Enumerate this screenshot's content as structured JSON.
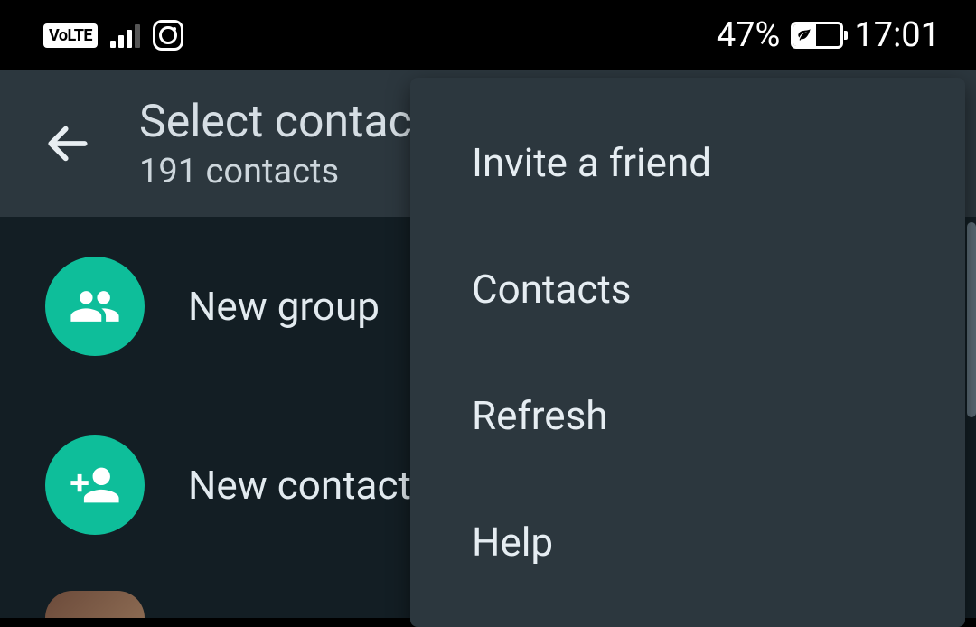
{
  "status_bar": {
    "volte": "VoLTE",
    "battery_pct": "47%",
    "time": "17:01"
  },
  "app_bar": {
    "title": "Select contact",
    "subtitle": "191 contacts"
  },
  "list": {
    "new_group": "New group",
    "new_contact": "New contact"
  },
  "menu": {
    "items": [
      "Invite a friend",
      "Contacts",
      "Refresh",
      "Help"
    ]
  },
  "colors": {
    "accent": "#0ebe9a",
    "bg_dark": "#131e24",
    "bg_panel": "#2c373e"
  }
}
